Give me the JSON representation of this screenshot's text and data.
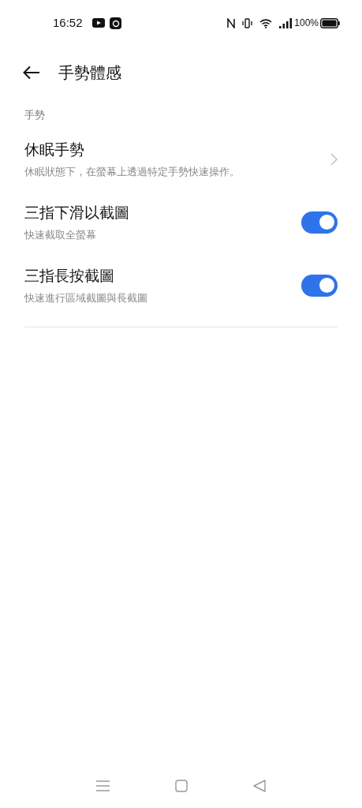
{
  "status_bar": {
    "time": "16:52",
    "battery": "100%"
  },
  "header": {
    "title": "手勢體感"
  },
  "section": {
    "label": "手勢"
  },
  "items": [
    {
      "kind": "link",
      "title": "休眠手勢",
      "subtitle": "休眠狀態下，在螢幕上透過特定手勢快速操作。"
    },
    {
      "kind": "toggle",
      "title": "三指下滑以截圖",
      "subtitle": "快速截取全螢幕",
      "on": true
    },
    {
      "kind": "toggle",
      "title": "三指長按截圖",
      "subtitle": "快速進行區域截圖與長截圖",
      "on": true
    }
  ]
}
